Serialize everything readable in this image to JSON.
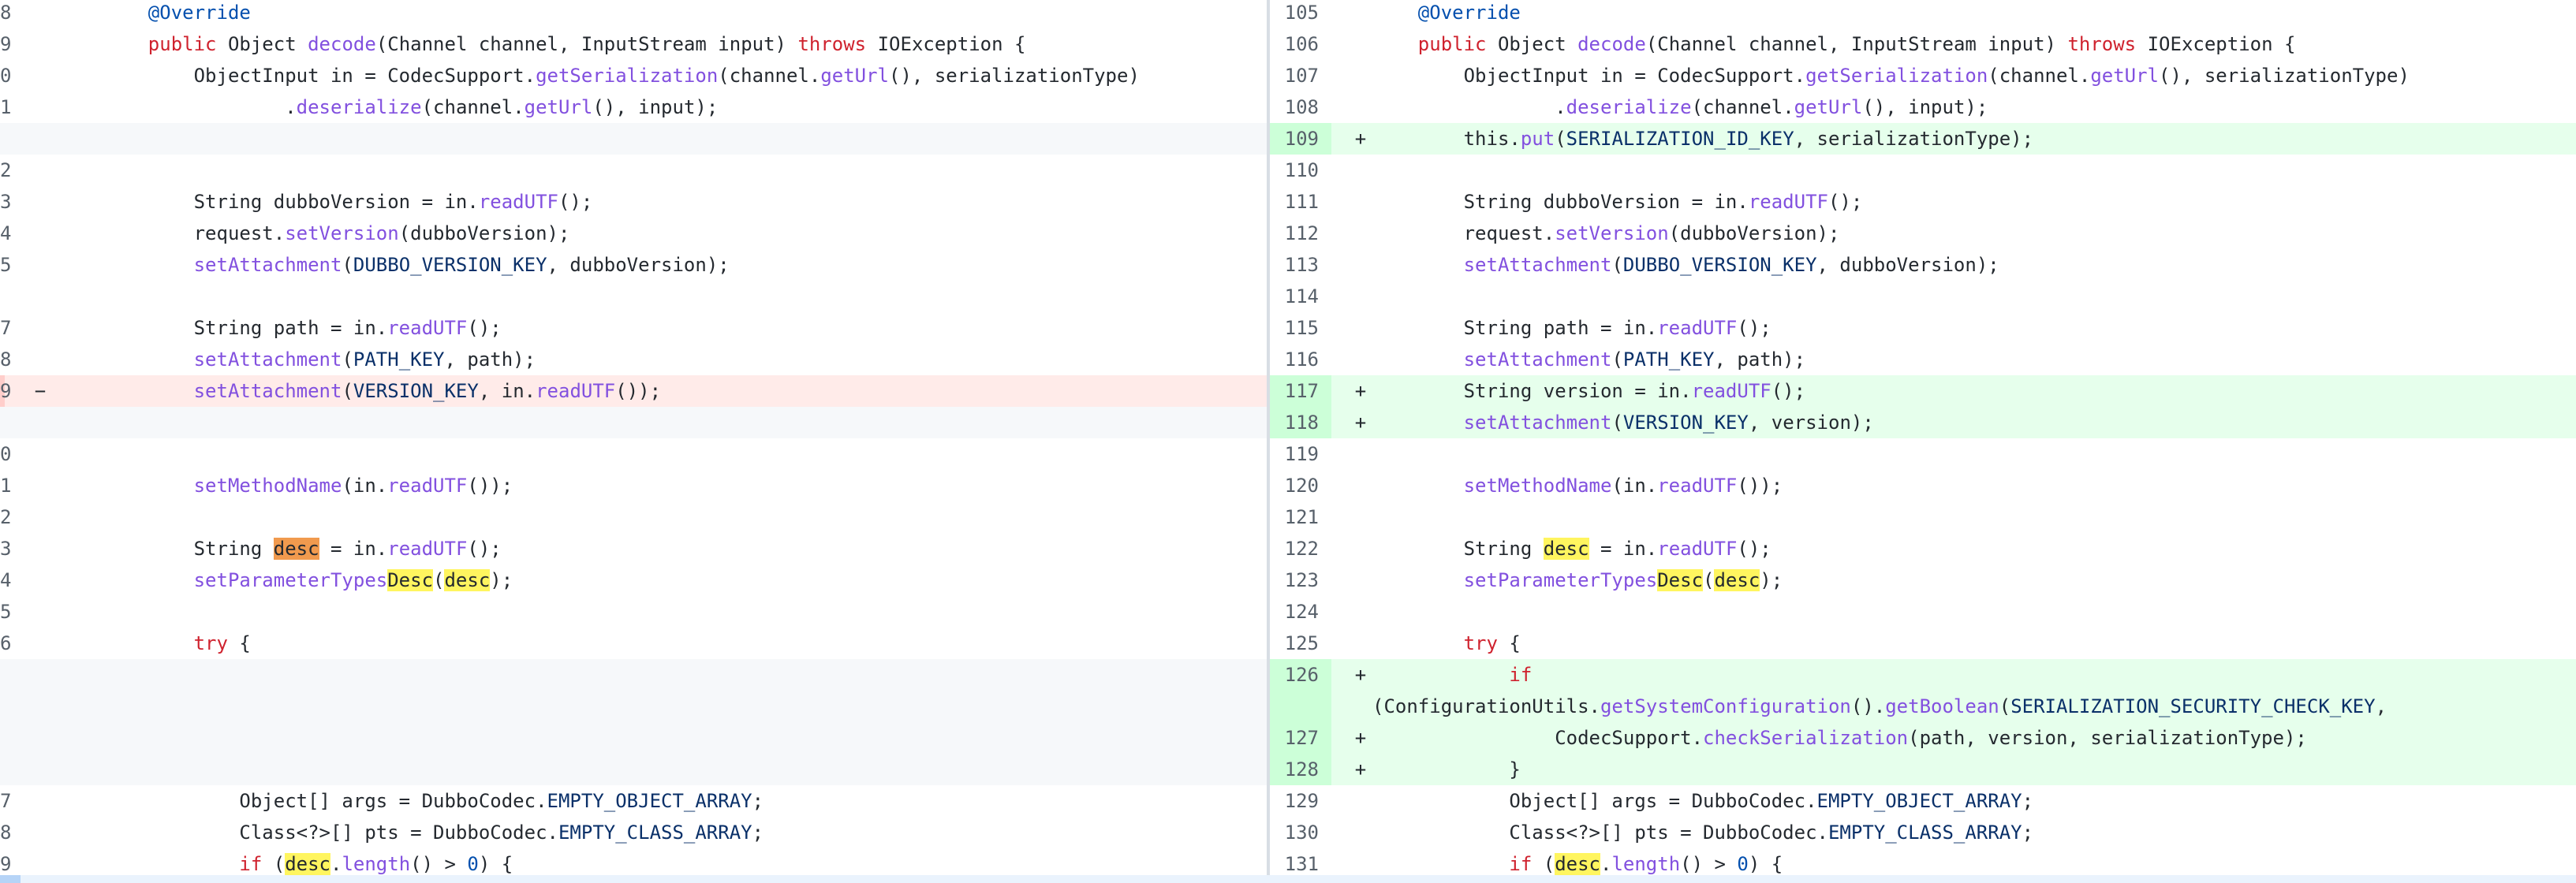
{
  "left": {
    "line_numbers": [
      "8",
      "9",
      "0",
      "1",
      "",
      "2",
      "3",
      "4",
      "5",
      "",
      "7",
      "8",
      "9",
      "",
      "0",
      "1",
      "2",
      "3",
      "4",
      "5",
      "6",
      "",
      "7",
      "8",
      "9"
    ],
    "deleted_sign": "−"
  },
  "right": {
    "line_numbers": [
      "105",
      "106",
      "107",
      "108",
      "109",
      "110",
      "111",
      "112",
      "113",
      "114",
      "115",
      "116",
      "117",
      "118",
      "119",
      "120",
      "121",
      "122",
      "123",
      "124",
      "125",
      "126",
      "127",
      "128",
      "129",
      "130",
      "131"
    ],
    "added_sign": "+"
  },
  "code": {
    "override": "@Override",
    "public": "public",
    "object": "Object",
    "decode": "decode",
    "decode_args": "(Channel channel, InputStream input)",
    "throws": "throws",
    "ioexception": "IOException {",
    "objectinput": "ObjectInput in = CodecSupport.",
    "getSerialization": "getSerialization",
    "channel_dot": "(channel.",
    "getUrl": "getUrl",
    "ser_type_tail": "(), serializationType)",
    "dot": ".",
    "deserialize": "deserialize",
    "input_tail": "(), input);",
    "this_dot": "this.",
    "put": "put",
    "open_paren": "(",
    "ser_id_key": "SERIALIZATION_ID_KEY",
    "put_tail": ", serializationType);",
    "string_dubbo": "String dubboVersion = in.",
    "readUTF": "readUTF",
    "semi_call": "();",
    "request_dot": "request.",
    "setVersion": "setVersion",
    "dubbo_arg": "(dubboVersion);",
    "setAttachment": "setAttachment",
    "dubbo_key": "DUBBO_VERSION_KEY",
    "dubbo_tail": ", dubboVersion);",
    "string_path": "String path = in.",
    "path_key": "PATH_KEY",
    "path_tail": ", path);",
    "version_key": "VERSION_KEY",
    "in_dot": ", in.",
    "double_call": "());",
    "string_version": "String version = in.",
    "version_tail": ", version);",
    "setMethodName": "setMethodName",
    "in_paren": "(in.",
    "string_kw": "String ",
    "desc": "desc",
    "eq_in": " = in.",
    "setParameterTypes": "setParameterTypes",
    "desc_cap": "Desc",
    "close_semi": ");",
    "try": "try",
    "brace_open": " {",
    "if": "if",
    "config_utils": " (ConfigurationUtils.",
    "getSystemConfiguration": "getSystemConfiguration",
    "paren_dot": "().",
    "getBoolean": "getBoolean",
    "sec_key": "SERIALIZATION_SECURITY_CHECK_KEY",
    "comma": ",",
    "false": "false",
    "close_brace": ")) {",
    "codec_support": "CodecSupport.",
    "checkSerialization": "checkSerialization",
    "check_args": "(path, version, serializationType);",
    "end_brace": "}",
    "object_args": "Object[] args = DubboCodec.",
    "empty_obj": "EMPTY_OBJECT_ARRAY",
    "semi": ";",
    "class_pts": "Class<?>[] pts = DubboCodec.",
    "empty_class": "EMPTY_CLASS_ARRAY",
    "if_open": " (",
    "length": "length",
    "gt": "() > ",
    "zero": "0",
    "close_if": ") {"
  },
  "colors": {
    "added_bg": "#e6ffec",
    "added_num_bg": "#ccffd8",
    "deleted_bg": "#ffebe9",
    "deleted_num_bg": "#ffcecb",
    "empty_bg": "#f6f8fa",
    "highlight": "#fff55f",
    "highlight_current": "#f19a4e"
  }
}
